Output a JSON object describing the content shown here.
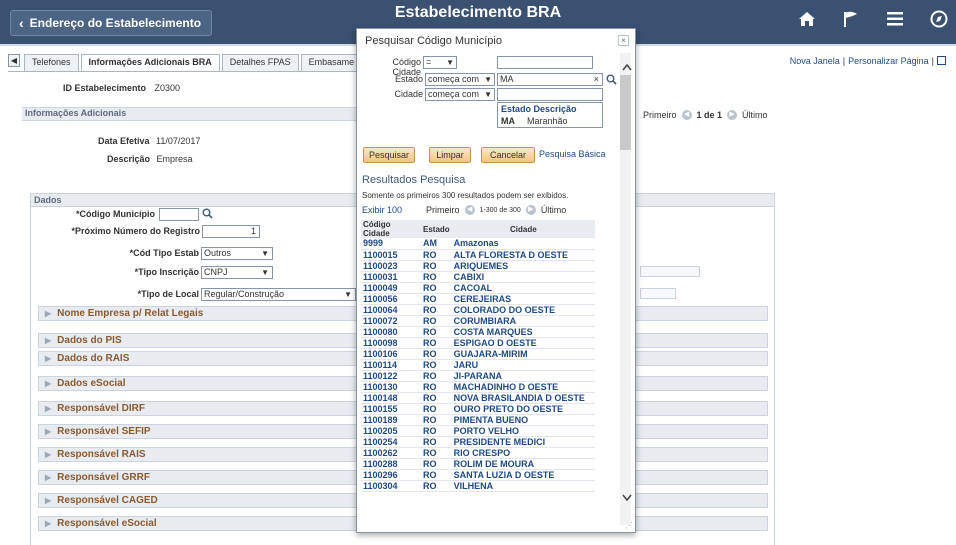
{
  "header": {
    "back_label": "Endereço do Estabelecimento",
    "title": "Estabelecimento BRA",
    "icons": [
      "home-icon",
      "flag-icon",
      "menu-icon",
      "navigation-icon"
    ]
  },
  "right_links": {
    "new_window": "Nova Janela",
    "personalize": "Personalizar Página"
  },
  "tabs": [
    {
      "label": "Telefones",
      "active": false
    },
    {
      "label": "Informações Adicionais BRA",
      "active": true
    },
    {
      "label": "Detalhes FPAS",
      "active": false
    },
    {
      "label": "Embasame",
      "active": false
    }
  ],
  "id_estab": {
    "label": "ID Estabelecimento",
    "value": "Z0300"
  },
  "info_section": "Informações Adicionais",
  "pager": {
    "first": "Primeiro",
    "range": "1 de 1",
    "last": "Último"
  },
  "data_efetiva": {
    "label": "Data Efetiva",
    "value": "11/07/2017"
  },
  "descricao": {
    "label": "Descrição",
    "value": "Empresa"
  },
  "dados": {
    "title": "Dados",
    "codigo_municipio_label": "*Código Município",
    "proximo_label": "*Próximo Número do Registro",
    "proximo_value": "1",
    "cod_tipo_label": "*Cód Tipo Estab",
    "cod_tipo_value": "Outros",
    "tipo_inscricao_label": "*Tipo Inscrição",
    "tipo_inscricao_value": "CNPJ",
    "tipo_local_label": "*Tipo de Local",
    "tipo_local_value": "Regular/Construção"
  },
  "collapsibles": [
    "Nome Empresa p/ Relat Legais",
    "Dados do PIS",
    "Dados do RAIS",
    "Dados eSocial",
    "Responsável DIRF",
    "Responsável SEFIP",
    "Responsável RAIS",
    "Responsável GRRF",
    "Responsável CAGED",
    "Responsável eSocial"
  ],
  "modal": {
    "title": "Pesquisar Código Município",
    "close": "×",
    "codigo_label": "Código Cidade",
    "codigo_op": "=",
    "estado_label": "Estado",
    "estado_op": "começa com",
    "estado_value": "MA",
    "cidade_label": "Cidade",
    "cidade_op": "começa com",
    "suggest_header": "Estado Descrição",
    "suggest_code": "MA",
    "suggest_desc": "Maranhão",
    "btn_search": "Pesquisar",
    "btn_clear": "Limpar",
    "btn_cancel": "Cancelar",
    "link_basic": "Pesquisa Básica",
    "results_title": "Resultados Pesquisa",
    "results_note": "Somente os primeiros 300 resultados podem ser exibidos.",
    "show": "Exibir 100",
    "first": "Primeiro",
    "range": "1-300 de 300",
    "last": "Último",
    "columns": [
      "Código Cidade",
      "Estado",
      "Cidade"
    ],
    "rows": [
      [
        "9999",
        "AM",
        "Amazonas"
      ],
      [
        "1100015",
        "RO",
        "ALTA FLORESTA D OESTE"
      ],
      [
        "1100023",
        "RO",
        "ARIQUEMES"
      ],
      [
        "1100031",
        "RO",
        "CABIXI"
      ],
      [
        "1100049",
        "RO",
        "CACOAL"
      ],
      [
        "1100056",
        "RO",
        "CEREJEIRAS"
      ],
      [
        "1100064",
        "RO",
        "COLORADO DO OESTE"
      ],
      [
        "1100072",
        "RO",
        "CORUMBIARA"
      ],
      [
        "1100080",
        "RO",
        "COSTA MARQUES"
      ],
      [
        "1100098",
        "RO",
        "ESPIGAO D OESTE"
      ],
      [
        "1100106",
        "RO",
        "GUAJARA-MIRIM"
      ],
      [
        "1100114",
        "RO",
        "JARU"
      ],
      [
        "1100122",
        "RO",
        "JI-PARANA"
      ],
      [
        "1100130",
        "RO",
        "MACHADINHO D OESTE"
      ],
      [
        "1100148",
        "RO",
        "NOVA BRASILANDIA D OESTE"
      ],
      [
        "1100155",
        "RO",
        "OURO PRETO DO OESTE"
      ],
      [
        "1100189",
        "RO",
        "PIMENTA BUENO"
      ],
      [
        "1100205",
        "RO",
        "PORTO VELHO"
      ],
      [
        "1100254",
        "RO",
        "PRESIDENTE MEDICI"
      ],
      [
        "1100262",
        "RO",
        "RIO CRESPO"
      ],
      [
        "1100288",
        "RO",
        "ROLIM DE MOURA"
      ],
      [
        "1100296",
        "RO",
        "SANTA LUZIA D OESTE"
      ],
      [
        "1100304",
        "RO",
        "VILHENA"
      ]
    ]
  }
}
